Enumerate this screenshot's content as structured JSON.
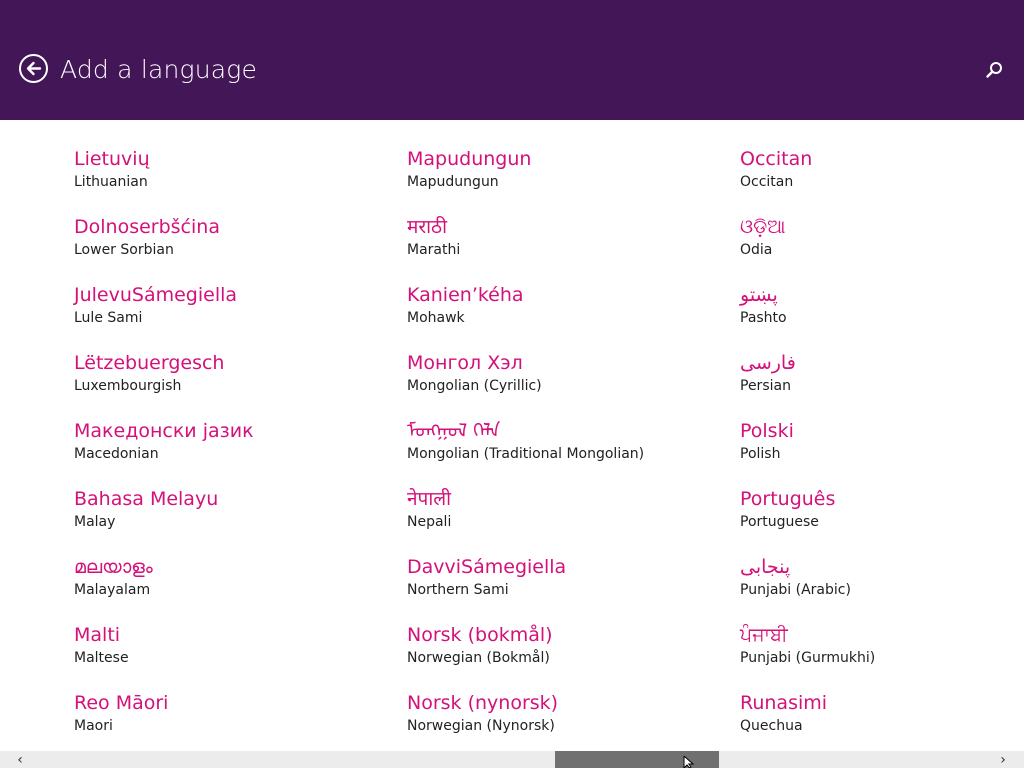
{
  "header": {
    "title": "Add a language",
    "back_icon": "back-arrow-icon",
    "search_icon": "search-icon",
    "background_color": "#431757"
  },
  "accent_color": "#d4117a",
  "columns": [
    [
      {
        "native": "Lietuvių",
        "english": "Lithuanian"
      },
      {
        "native": "Dolnoserbšćina",
        "english": "Lower Sorbian"
      },
      {
        "native": "JulevuSámegiella",
        "english": "Lule Sami"
      },
      {
        "native": "Lëtzebuergesch",
        "english": "Luxembourgish"
      },
      {
        "native": "Македонски јазик",
        "english": "Macedonian"
      },
      {
        "native": "Bahasa Melayu",
        "english": "Malay"
      },
      {
        "native": "മലയാളം",
        "english": "Malayalam"
      },
      {
        "native": "Malti",
        "english": "Maltese"
      },
      {
        "native": "Reo Māori",
        "english": "Maori"
      }
    ],
    [
      {
        "native": "Mapudungun",
        "english": "Mapudungun"
      },
      {
        "native": "मराठी",
        "english": "Marathi"
      },
      {
        "native": "Kanien’kéha",
        "english": "Mohawk"
      },
      {
        "native": "Монгол Хэл",
        "english": "Mongolian (Cyrillic)"
      },
      {
        "native": "ᠮᠣᠩᠭᠣᠯ ᠬᠡᠯᠡ",
        "english": "Mongolian (Traditional Mongolian)"
      },
      {
        "native": "नेपाली",
        "english": "Nepali"
      },
      {
        "native": "DavviSámegiella",
        "english": "Northern Sami"
      },
      {
        "native": "Norsk (bokmål)",
        "english": "Norwegian (Bokmål)"
      },
      {
        "native": "Norsk (nynorsk)",
        "english": "Norwegian (Nynorsk)"
      }
    ],
    [
      {
        "native": "Occitan",
        "english": "Occitan"
      },
      {
        "native": "ଓଡ଼ିଆ",
        "english": "Odia"
      },
      {
        "native": "پښتو",
        "english": "Pashto"
      },
      {
        "native": "فارسی",
        "english": "Persian"
      },
      {
        "native": "Polski",
        "english": "Polish"
      },
      {
        "native": "Português",
        "english": "Portuguese"
      },
      {
        "native": "پنجابی",
        "english": "Punjabi (Arabic)"
      },
      {
        "native": "ਪੰਜਾਬੀ",
        "english": "Punjabi (Gurmukhi)"
      },
      {
        "native": "Runasimi",
        "english": "Quechua"
      }
    ]
  ],
  "scrollbar": {
    "left_arrow": "‹",
    "right_arrow": "›",
    "position_fraction": 0.54
  }
}
